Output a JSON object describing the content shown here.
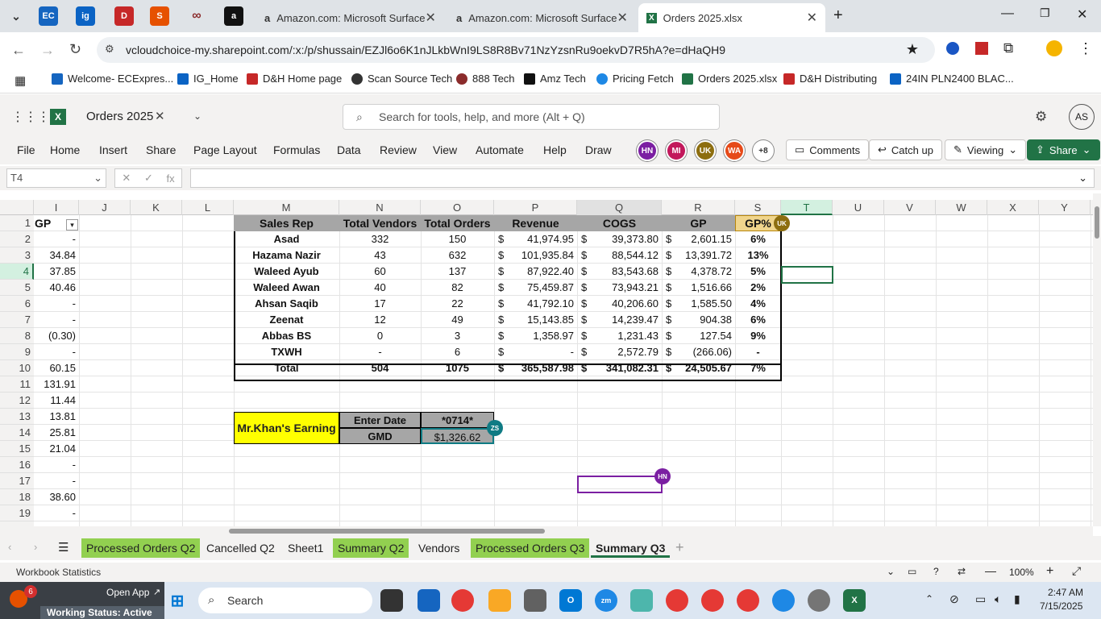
{
  "colors": {
    "accent": "#217346",
    "yellow": "#ffff00",
    "green_tab": "#92d050",
    "header_gray": "#a6a6a6",
    "teal": "#0f7b84"
  },
  "browser": {
    "tabs": [
      {
        "label": "Amazon.com: Microsoft Surface",
        "icon": "amazon-icon"
      },
      {
        "label": "Amazon.com: Microsoft Surface",
        "icon": "amazon-icon"
      },
      {
        "label": "Orders 2025.xlsx",
        "icon": "excel-icon"
      }
    ],
    "url": "vcloudchoice-my.sharepoint.com/:x:/p/shussain/EZJl6o6K1nJLkbWnI9LS8R8Bv71NzYzsnRu9oekvD7R5hA?e=dHaQH9",
    "bookmarks": [
      "Welcome- ECExpres...",
      "IG_Home",
      "D&H Home page",
      "Scan Source Tech",
      "888 Tech",
      "Amz Tech",
      "Pricing Fetch",
      "Orders 2025.xlsx",
      "D&H Distributing",
      "24IN PLN2400 BLAC..."
    ]
  },
  "excel": {
    "title": "Orders 2025",
    "search_placeholder": "Search for tools, help, and more (Alt + Q)",
    "user_initials": "AS",
    "ribbon_tabs": [
      "File",
      "Home",
      "Insert",
      "Share",
      "Page Layout",
      "Formulas",
      "Data",
      "Review",
      "View",
      "Automate",
      "Help",
      "Draw"
    ],
    "collaborators": [
      {
        "initials": "HN",
        "color": "#7b1fa2"
      },
      {
        "initials": "MI",
        "color": "#c2185b"
      },
      {
        "initials": "UK",
        "color": "#8d6e0f"
      },
      {
        "initials": "WA",
        "color": "#e64a19"
      }
    ],
    "more_collaborators": "+8",
    "comments_label": "Comments",
    "catchup_label": "Catch up",
    "viewing_label": "Viewing",
    "share_label": "Share",
    "name_box": "T4",
    "fx": "fx"
  },
  "columns": [
    "I",
    "J",
    "K",
    "L",
    "M",
    "N",
    "O",
    "P",
    "Q",
    "R",
    "S",
    "T",
    "U",
    "V",
    "W",
    "X",
    "Y"
  ],
  "rows": [
    "1",
    "2",
    "3",
    "4",
    "5",
    "6",
    "7",
    "8",
    "9",
    "10",
    "11",
    "12",
    "13",
    "14",
    "15",
    "16",
    "17",
    "18",
    "19"
  ],
  "col_i": {
    "header": "GP",
    "values": [
      "-",
      "34.84",
      "37.85",
      "40.46",
      "-",
      "-",
      "(0.30)",
      "-",
      "60.15",
      "131.91",
      "11.44",
      "13.81",
      "25.81",
      "21.04",
      "-",
      "-",
      "38.60",
      "-"
    ]
  },
  "summary": {
    "headers": [
      "Sales Rep",
      "Total Vendors",
      "Total Orders",
      "Revenue",
      "COGS",
      "GP",
      "GP%"
    ],
    "rows": [
      {
        "rep": "Asad",
        "vendors": "332",
        "orders": "150",
        "revenue": "41,974.95",
        "cogs": "39,373.80",
        "gp": "2,601.15",
        "gpp": "6%"
      },
      {
        "rep": "Hazama Nazir",
        "vendors": "43",
        "orders": "632",
        "revenue": "101,935.84",
        "cogs": "88,544.12",
        "gp": "13,391.72",
        "gpp": "13%"
      },
      {
        "rep": "Waleed Ayub",
        "vendors": "60",
        "orders": "137",
        "revenue": "87,922.40",
        "cogs": "83,543.68",
        "gp": "4,378.72",
        "gpp": "5%"
      },
      {
        "rep": "Waleed Awan",
        "vendors": "40",
        "orders": "82",
        "revenue": "75,459.87",
        "cogs": "73,943.21",
        "gp": "1,516.66",
        "gpp": "2%"
      },
      {
        "rep": "Ahsan Saqib",
        "vendors": "17",
        "orders": "22",
        "revenue": "41,792.10",
        "cogs": "40,206.60",
        "gp": "1,585.50",
        "gpp": "4%"
      },
      {
        "rep": "Zeenat",
        "vendors": "12",
        "orders": "49",
        "revenue": "15,143.85",
        "cogs": "14,239.47",
        "gp": "904.38",
        "gpp": "6%"
      },
      {
        "rep": "Abbas BS",
        "vendors": "0",
        "orders": "3",
        "revenue": "1,358.97",
        "cogs": "1,231.43",
        "gp": "127.54",
        "gpp": "9%"
      },
      {
        "rep": "TXWH",
        "vendors": "-",
        "orders": "6",
        "revenue": "-",
        "cogs": "2,572.79",
        "gp": "(266.06)",
        "gpp": "-"
      },
      {
        "rep": "Total",
        "vendors": "504",
        "orders": "1075",
        "revenue": "365,587.98",
        "cogs": "341,082.31",
        "gp": "24,505.67",
        "gpp": "7%"
      }
    ],
    "currency": "$"
  },
  "earning": {
    "label": "Mr.Khan's Earning",
    "enter_date": "Enter Date",
    "date_value": "*0714*",
    "gmd": "GMD",
    "gmd_value": "$1,326.62"
  },
  "cell_badges": {
    "uk": "UK",
    "zs": "ZS",
    "hn": "HN"
  },
  "sheets": [
    {
      "label": "Processed Orders Q2",
      "green": true
    },
    {
      "label": "Cancelled Q2",
      "green": false
    },
    {
      "label": "Sheet1",
      "green": false
    },
    {
      "label": "Summary Q2",
      "green": true
    },
    {
      "label": "Vendors",
      "green": false
    },
    {
      "label": "Processed Orders Q3",
      "green": true
    },
    {
      "label": "Summary Q3",
      "green": false
    }
  ],
  "status": {
    "left": "Workbook Statistics",
    "zoom": "100%"
  },
  "taskbar": {
    "search": "Search",
    "open_app": "Open App",
    "working_status": "Working Status: Active",
    "badge": "6",
    "time": "2:47 AM",
    "date": "7/15/2025"
  }
}
